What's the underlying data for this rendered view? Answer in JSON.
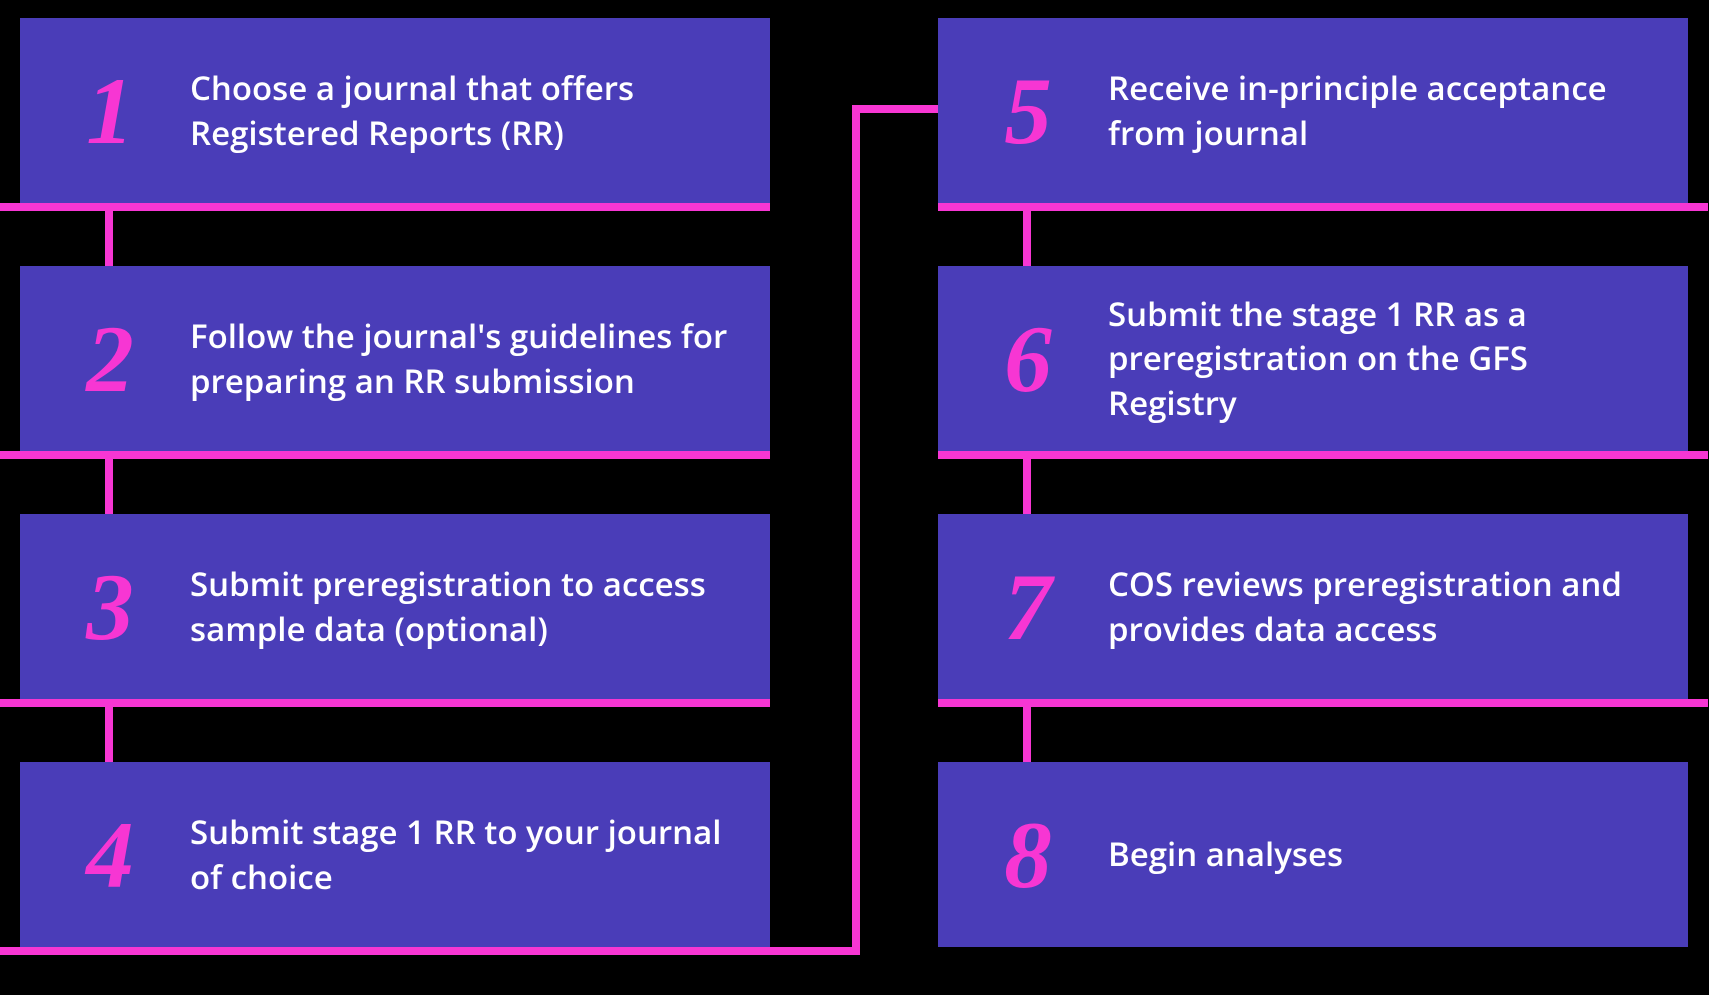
{
  "colors": {
    "box_bg": "#4a3db8",
    "accent": "#f736d3",
    "text": "#ffffff",
    "bg": "#000000"
  },
  "steps": [
    {
      "num": "1",
      "text": "Choose a journal that offers Registered Reports (RR)"
    },
    {
      "num": "2",
      "text": "Follow the journal's guidelines for preparing an RR submission"
    },
    {
      "num": "3",
      "text": "Submit preregistration to access sample data (optional)"
    },
    {
      "num": "4",
      "text": "Submit stage 1 RR to your journal of choice"
    },
    {
      "num": "5",
      "text": "Receive in-principle acceptance from journal"
    },
    {
      "num": "6",
      "text": "Submit the stage 1 RR as a preregistration on the GFS Registry"
    },
    {
      "num": "7",
      "text": "COS reviews preregistration and provides data access"
    },
    {
      "num": "8",
      "text": "Begin analyses"
    }
  ]
}
